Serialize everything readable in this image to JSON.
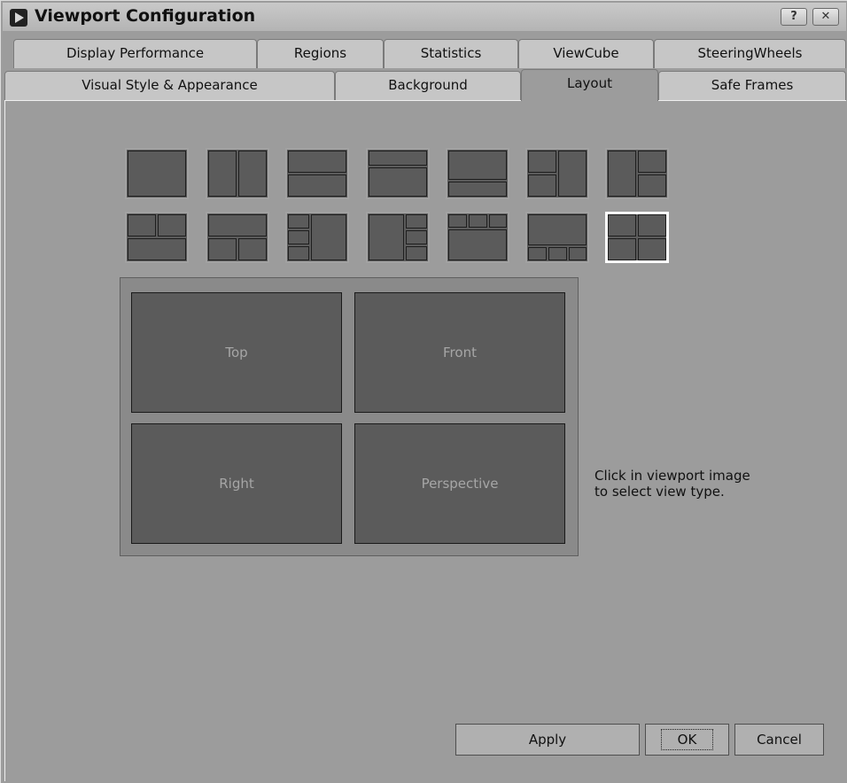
{
  "window": {
    "title": "Viewport Configuration",
    "help_label": "?",
    "close_label": "✕"
  },
  "tabs_row1": [
    {
      "label": "Display Performance"
    },
    {
      "label": "Regions"
    },
    {
      "label": "Statistics"
    },
    {
      "label": "ViewCube"
    },
    {
      "label": "SteeringWheels"
    }
  ],
  "tabs_row2": [
    {
      "label": "Visual Style & Appearance"
    },
    {
      "label": "Background"
    },
    {
      "label": "Layout",
      "active": true
    },
    {
      "label": "Safe Frames"
    }
  ],
  "layout_presets": {
    "count": 14,
    "selected_index": 13
  },
  "viewports": [
    {
      "label": "Top"
    },
    {
      "label": "Front"
    },
    {
      "label": "Right"
    },
    {
      "label": "Perspective"
    }
  ],
  "hint_text": "Click in viewport image to select view type.",
  "buttons": {
    "apply": "Apply",
    "ok": "OK",
    "cancel": "Cancel"
  },
  "colors": {
    "dialog_bg": "#9c9c9c",
    "viewport_fill": "#5b5b5b",
    "selected_border": "#ffffff"
  }
}
